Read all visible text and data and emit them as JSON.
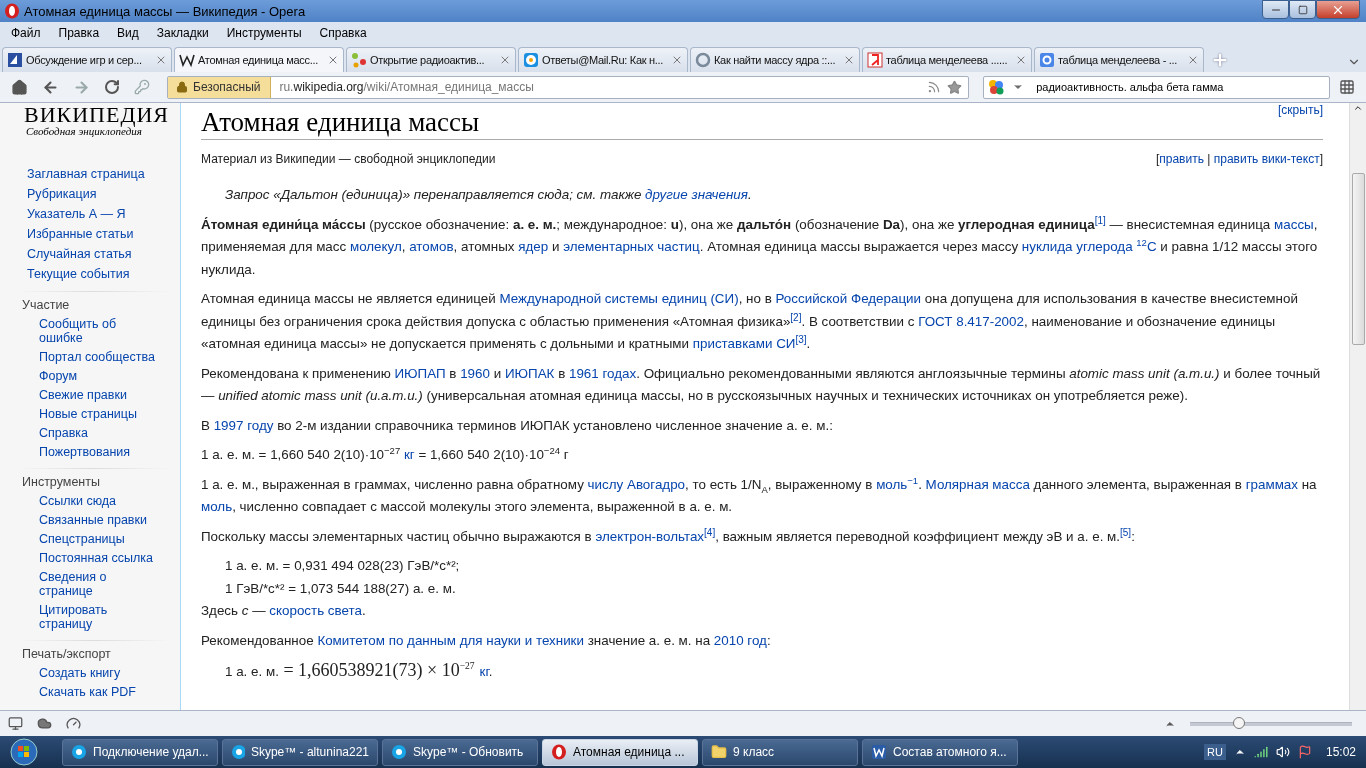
{
  "window": {
    "title": "Атомная единица массы — Википедия - Opera"
  },
  "menu": [
    "Файл",
    "Правка",
    "Вид",
    "Закладки",
    "Инструменты",
    "Справка"
  ],
  "tabs": [
    {
      "label": "Обсуждение игр и сер...",
      "selected": false
    },
    {
      "label": "Атомная единица масс...",
      "selected": true
    },
    {
      "label": "Открытие радиоактив...",
      "selected": false
    },
    {
      "label": "Ответы@Mail.Ru: Как н...",
      "selected": false
    },
    {
      "label": "Как найти массу ядра ::...",
      "selected": false
    },
    {
      "label": "таблица менделеева ......",
      "selected": false
    },
    {
      "label": "таблица менделеева - ...",
      "selected": false
    }
  ],
  "address": {
    "security": "Безопасный",
    "url": "ru.**wikipedia.org**/wiki/Атомная_единица_массы"
  },
  "search": {
    "value": "радиоактивность. альфа бета гамма"
  },
  "sidebar": {
    "logo_title": "ВИКИПЕДИЯ",
    "logo_subtitle": "Свободная энциклопедия",
    "items": [
      "Заглавная страница",
      "Рубрикация",
      "Указатель А — Я",
      "Избранные статьи",
      "Случайная статья",
      "Текущие события"
    ],
    "sections": [
      {
        "heading": "Участие",
        "items": [
          "Сообщить об ошибке",
          "Портал сообщества",
          "Форум",
          "Свежие правки",
          "Новые страницы",
          "Справка",
          "Пожертвования"
        ]
      },
      {
        "heading": "Инструменты",
        "items": [
          "Ссылки сюда",
          "Связанные правки",
          "Спецстраницы",
          "Постоянная ссылка",
          "Сведения о странице",
          "Цитировать страницу"
        ]
      },
      {
        "heading": "Печать/экспорт",
        "items": [
          "Создать книгу",
          "Скачать как PDF"
        ]
      }
    ]
  },
  "article": {
    "hide_link": "[скрыть]",
    "title": "Атомная единица массы",
    "tagline": "Материал из Википедии — свободной энциклопедии",
    "edit_links": [
      {
        "kind": "text",
        "text": "["
      },
      {
        "kind": "link",
        "text": "править"
      },
      {
        "kind": "text",
        "text": " | "
      },
      {
        "kind": "link",
        "text": "править вики-текст"
      },
      {
        "kind": "text",
        "text": "]"
      }
    ],
    "paragraphs": [
      {
        "kind": "hatnote",
        "segments": [
          {
            "kind": "text",
            "text": "Запрос «Дальтон (единица)» перенаправляется сюда; см. также "
          },
          {
            "kind": "link",
            "text": "другие значения"
          },
          {
            "kind": "text",
            "text": "."
          }
        ]
      },
      {
        "kind": "text",
        "segments": [
          {
            "kind": "text",
            "text": "**А́томная едини́ца ма́ссы** (русское обозначение: **а. е. м.**; международное: **u**), она же **дальто́н** (обозначение **Da**), она же **углеродная единица**"
          },
          {
            "kind": "ref",
            "text": "[1]"
          },
          {
            "kind": "text",
            "text": " — внесистемная единица "
          },
          {
            "kind": "link",
            "text": "массы"
          },
          {
            "kind": "text",
            "text": ", применяемая для масс "
          },
          {
            "kind": "link",
            "text": "молекул"
          },
          {
            "kind": "text",
            "text": ", "
          },
          {
            "kind": "link",
            "text": "атомов"
          },
          {
            "kind": "text",
            "text": ", атомных "
          },
          {
            "kind": "link",
            "text": "ядер"
          },
          {
            "kind": "text",
            "text": " и "
          },
          {
            "kind": "link",
            "text": "элементарных частиц"
          },
          {
            "kind": "text",
            "text": ". Атомная единица массы выражается через массу "
          },
          {
            "kind": "link",
            "text": "нуклида углерода $^{12}$C"
          },
          {
            "kind": "text",
            "text": " и равна 1/12 массы этого нуклида."
          }
        ]
      },
      {
        "kind": "text",
        "segments": [
          {
            "kind": "text",
            "text": "Атомная единица массы не является единицей "
          },
          {
            "kind": "link",
            "text": "Международной системы единиц (СИ)"
          },
          {
            "kind": "text",
            "text": ", но в "
          },
          {
            "kind": "link",
            "text": "Российской Федерации"
          },
          {
            "kind": "text",
            "text": " она допущена для использования в качестве внесистемной единицы без ограничения срока действия допуска с областью применения «Атомная физика»"
          },
          {
            "kind": "ref",
            "text": "[2]"
          },
          {
            "kind": "text",
            "text": ". В соответствии с "
          },
          {
            "kind": "link",
            "text": "ГОСТ 8.417-2002"
          },
          {
            "kind": "text",
            "text": ", наименование и обозначение единицы «атомная единица массы» не допускается применять с дольными и кратными "
          },
          {
            "kind": "link",
            "text": "приставками СИ"
          },
          {
            "kind": "ref",
            "text": "[3]"
          },
          {
            "kind": "text",
            "text": "."
          }
        ]
      },
      {
        "kind": "text",
        "segments": [
          {
            "kind": "text",
            "text": "Рекомендована к применению "
          },
          {
            "kind": "link",
            "text": "ИЮПАП"
          },
          {
            "kind": "text",
            "text": " в "
          },
          {
            "kind": "link",
            "text": "1960"
          },
          {
            "kind": "text",
            "text": " и "
          },
          {
            "kind": "link",
            "text": "ИЮПАК"
          },
          {
            "kind": "text",
            "text": " в "
          },
          {
            "kind": "link",
            "text": "1961 годах"
          },
          {
            "kind": "text",
            "text": ". Официально рекомендованными являются англоязычные термины *atomic mass unit (a.m.u.)* и более точный — *unified atomic mass unit (u.a.m.u.)* (универсальная атомная единица массы, но в русскоязычных научных и технических источниках он употребляется реже)."
          }
        ]
      },
      {
        "kind": "text",
        "segments": [
          {
            "kind": "text",
            "text": "В "
          },
          {
            "kind": "link",
            "text": "1997 году"
          },
          {
            "kind": "text",
            "text": " во 2-м издании справочника терминов ИЮПАК установлено численное значение а. е. м.:"
          }
        ]
      },
      {
        "kind": "text",
        "segments": [
          {
            "kind": "text",
            "text": "1 а. е. м. = 1,660 540 2(10)·10$^{−27}$ "
          },
          {
            "kind": "link",
            "text": "кг"
          },
          {
            "kind": "text",
            "text": " = 1,660 540 2(10)·10$^{−24}$ г"
          }
        ]
      },
      {
        "kind": "text",
        "segments": [
          {
            "kind": "text",
            "text": "1 а. е. м., выраженная в граммах, численно равна обратному "
          },
          {
            "kind": "link",
            "text": "числу Авогадро"
          },
          {
            "kind": "text",
            "text": ", то есть 1/N$_{A}$, выраженному в "
          },
          {
            "kind": "link",
            "text": "моль$^{−1}$"
          },
          {
            "kind": "text",
            "text": ". "
          },
          {
            "kind": "link",
            "text": "Молярная масса"
          },
          {
            "kind": "text",
            "text": " данного элемента, выраженная в "
          },
          {
            "kind": "link",
            "text": "граммах"
          },
          {
            "kind": "text",
            "text": " на "
          },
          {
            "kind": "link",
            "text": "моль"
          },
          {
            "kind": "text",
            "text": ", численно совпадает с массой молекулы этого элемента, выраженной в а. е. м."
          }
        ]
      },
      {
        "kind": "text",
        "segments": [
          {
            "kind": "text",
            "text": "Поскольку массы элементарных частиц обычно выражаются в "
          },
          {
            "kind": "link",
            "text": "электрон-вольтах"
          },
          {
            "kind": "ref",
            "text": "[4]"
          },
          {
            "kind": "text",
            "text": ", важным является переводной коэффициент между эВ и а. е. м."
          },
          {
            "kind": "ref",
            "text": "[5]"
          },
          {
            "kind": "text",
            "text": ":"
          }
        ]
      },
      {
        "kind": "indent",
        "segments": [
          {
            "kind": "text",
            "text": "1 а. е. м. = 0,931 494 028(23) ГэВ/*c*²;"
          }
        ]
      },
      {
        "kind": "indent",
        "segments": [
          {
            "kind": "text",
            "text": "1 ГэВ/*c*² = 1,073 544 188(27) а. е. м."
          }
        ]
      },
      {
        "kind": "text",
        "segments": [
          {
            "kind": "text",
            "text": "Здесь *c* — "
          },
          {
            "kind": "link",
            "text": "скорость света"
          },
          {
            "kind": "text",
            "text": "."
          }
        ]
      },
      {
        "kind": "text",
        "segments": [
          {
            "kind": "text",
            "text": "Рекомендованное "
          },
          {
            "kind": "link",
            "text": "Комитетом по данным для науки и техники"
          },
          {
            "kind": "text",
            "text": " значение а. е. м. на "
          },
          {
            "kind": "link",
            "text": "2010 год"
          },
          {
            "kind": "text",
            "text": ":"
          }
        ]
      },
      {
        "kind": "formula",
        "segments": [
          {
            "kind": "text",
            "text": "1 а. е. м."
          },
          {
            "kind": "math",
            "text": "= 1,660538921(73) × 10$^{−27}$"
          },
          {
            "kind": "link",
            "text": "кг"
          },
          {
            "kind": "text",
            "text": "."
          }
        ]
      }
    ]
  },
  "zoom": {
    "level": 0.3
  },
  "taskbar": {
    "items": [
      {
        "label": "Подключение удал...",
        "selected": false
      },
      {
        "label": "Skype™ - altunina221",
        "selected": false
      },
      {
        "label": "Skype™ - Обновить",
        "selected": false
      },
      {
        "label": "Атомная единица ...",
        "selected": true
      },
      {
        "label": "9 класс",
        "selected": false
      },
      {
        "label": "Состав атомного я...",
        "selected": false
      }
    ],
    "language": "RU",
    "clock": "15:02"
  }
}
